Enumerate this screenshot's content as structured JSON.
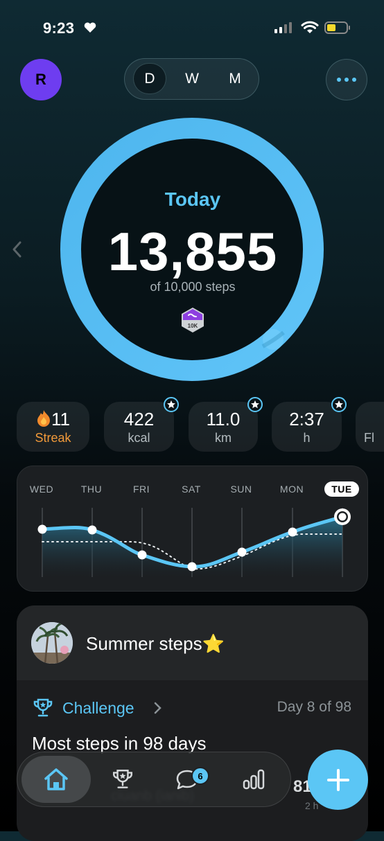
{
  "status_bar": {
    "time": "9:23"
  },
  "header": {
    "avatar_initial": "R",
    "periods": [
      "D",
      "W",
      "M"
    ],
    "selected_period": "D"
  },
  "ring": {
    "label": "Today",
    "steps": "13,855",
    "goal_text": "of 10,000 steps",
    "badge": "10K",
    "progress": 1.0
  },
  "stats": [
    {
      "value": "11",
      "label": "Streak"
    },
    {
      "value": "422",
      "label": "kcal"
    },
    {
      "value": "11.0",
      "label": "km"
    },
    {
      "value": "2:37",
      "label": "h"
    },
    {
      "value": "",
      "label": "Fl"
    }
  ],
  "week_chart": {
    "days": [
      "WED",
      "THU",
      "FRI",
      "SAT",
      "SUN",
      "MON",
      "TUE"
    ],
    "selected_day": "TUE"
  },
  "summer_card": {
    "title": "Summer steps⭐",
    "challenge_label": "Challenge",
    "day_of": "Day 8 of 98",
    "challenge_title": "Most steps in 98 days"
  },
  "nav": {
    "messages_badge": "6",
    "partial_value": "81",
    "partial_sub": "2 h"
  },
  "colors": {
    "accent": "#5bc6f5",
    "avatar": "#6e3df0",
    "streak": "#f29a3a"
  }
}
